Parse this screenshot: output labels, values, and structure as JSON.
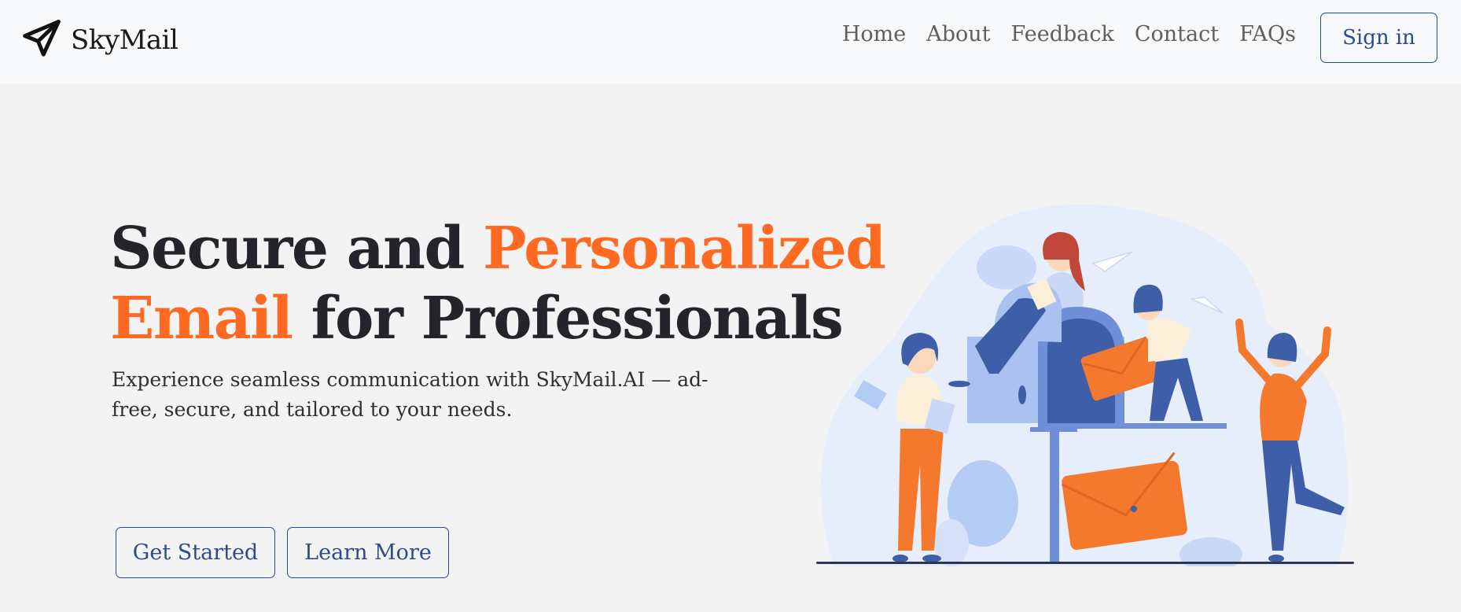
{
  "brand": {
    "name": "SkyMail",
    "icon": "paper-plane-icon"
  },
  "nav": {
    "links": [
      "Home",
      "About",
      "Feedback",
      "Contact",
      "FAQs"
    ],
    "signin_label": "Sign in"
  },
  "hero": {
    "title_line1_plain": "Secure and ",
    "title_line1_accent": "Personalized",
    "title_line2_accent": "Email",
    "title_line2_plain": " for Professionals",
    "subtitle": "Experience seamless communication with SkyMail.AI — ad-free, secure, and tailored to your needs.",
    "get_started_label": "Get Started",
    "learn_more_label": "Learn More"
  },
  "colors": {
    "accent": "#ff6a22",
    "primary": "#2b4b8b",
    "illustration_blue": "#3f5ea8",
    "illustration_light_blue": "#a9c2f1",
    "illustration_bg": "#e6eefb"
  }
}
